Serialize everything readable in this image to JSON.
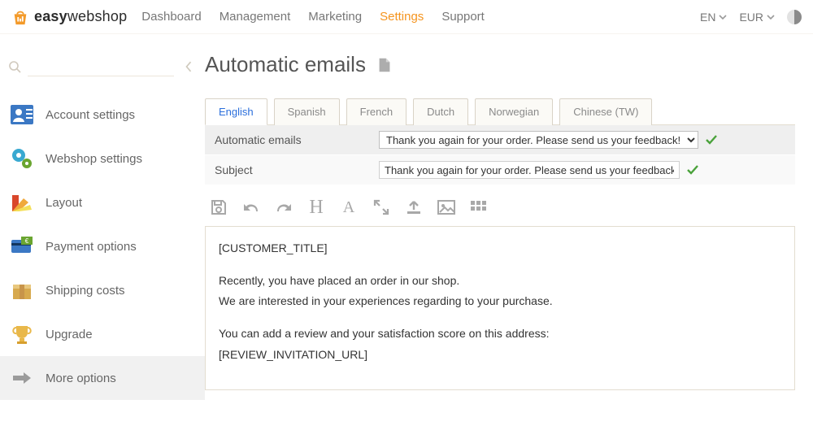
{
  "brand": {
    "bold": "easy",
    "rest": "webshop"
  },
  "nav": {
    "items": [
      "Dashboard",
      "Management",
      "Marketing",
      "Settings",
      "Support"
    ],
    "active_index": 3
  },
  "top_right": {
    "language": "EN",
    "currency": "EUR"
  },
  "sidebar": {
    "search_placeholder": "",
    "collapse_hint": "Collapse",
    "items": [
      {
        "label": "Account settings",
        "icon": "account"
      },
      {
        "label": "Webshop settings",
        "icon": "gears"
      },
      {
        "label": "Layout",
        "icon": "swatches"
      },
      {
        "label": "Payment options",
        "icon": "card"
      },
      {
        "label": "Shipping costs",
        "icon": "box"
      },
      {
        "label": "Upgrade",
        "icon": "trophy"
      },
      {
        "label": "More options",
        "icon": "arrow"
      }
    ],
    "active_index": 6
  },
  "page": {
    "title": "Automatic emails"
  },
  "lang_tabs": {
    "items": [
      "English",
      "Spanish",
      "French",
      "Dutch",
      "Norwegian",
      "Chinese (TW)"
    ],
    "active_index": 0
  },
  "form": {
    "rows": [
      {
        "label": "Automatic emails",
        "value": "Thank you again for your order. Please send us your feedback!"
      },
      {
        "label": "Subject",
        "value": "Thank you again for your order. Please send us your feedback!"
      }
    ]
  },
  "toolbar": {
    "save": "Save",
    "undo": "Undo",
    "redo": "Redo",
    "heading_glyph": "H",
    "fontsize_glyph": "A",
    "fullscreen": "Fullscreen",
    "upload": "Upload",
    "image": "Image",
    "grid": "Grid"
  },
  "editor": {
    "lines": [
      "[CUSTOMER_TITLE]",
      "",
      "Recently, you have placed an order in our shop.",
      "We are interested in your experiences regarding to your purchase.",
      "",
      "You can add a review and your satisfaction score on this address:",
      "[REVIEW_INVITATION_URL]"
    ]
  }
}
